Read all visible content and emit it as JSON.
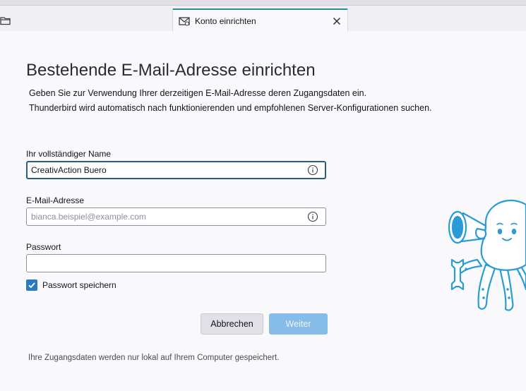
{
  "tab": {
    "label": "Konto einrichten"
  },
  "page": {
    "title": "Bestehende E-Mail-Adresse einrichten",
    "description_line1": "Geben Sie zur Verwendung Ihrer derzeitigen E-Mail-Adresse deren Zugangsdaten ein.",
    "description_line2": "Thunderbird wird automatisch nach funktionierenden und empfohlenen Server-Konfigurationen suchen."
  },
  "form": {
    "name_label": "Ihr vollständiger Name",
    "name_value": "CreativAction Buero",
    "email_label": "E-Mail-Adresse",
    "email_placeholder": "bianca.beispiel@example.com",
    "email_value": "",
    "password_label": "Passwort",
    "password_value": "",
    "remember_password_label": "Passwort speichern",
    "remember_password_checked": true
  },
  "buttons": {
    "cancel_label": "Abbrechen",
    "next_label": "Weiter"
  },
  "footer": {
    "note": "Ihre Zugangsdaten werden nur lokal auf Ihrem Computer gespeichert."
  },
  "icons": {
    "folder": "folder-icon",
    "tab": "mail-setup-icon",
    "close": "close-icon",
    "info": "info-icon",
    "check": "checkmark-icon",
    "mascot": "octopus-mascot-illustration"
  },
  "colors": {
    "accent": "#2a7ac2",
    "focus_border": "#2a5d84",
    "next_button": "#86bde8",
    "mascot": "#2a9bd6"
  }
}
